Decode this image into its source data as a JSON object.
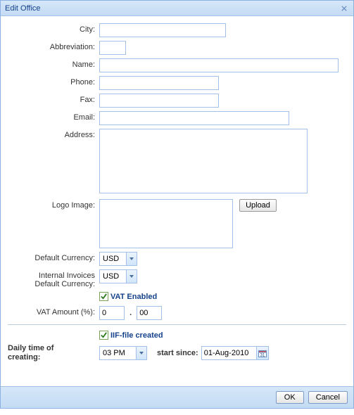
{
  "window": {
    "title": "Edit Office"
  },
  "labels": {
    "city": "City:",
    "abbreviation": "Abbreviation:",
    "name": "Name:",
    "phone": "Phone:",
    "fax": "Fax:",
    "email": "Email:",
    "address": "Address:",
    "logo": "Logo Image:",
    "def_currency": "Default Currency:",
    "int_inv_currency_l1": "Internal Invoices",
    "int_inv_currency_l2": "Default Currency:",
    "vat_enabled": "VAT Enabled",
    "vat_amount": "VAT Amount (%):",
    "iif_created": "IIF-file created",
    "daily_time_l1": "Daily time of",
    "daily_time_l2": "creating:",
    "start_since": "start since:"
  },
  "fields": {
    "city": "",
    "abbreviation": "",
    "name": "",
    "phone": "",
    "fax": "",
    "email": "",
    "address": "",
    "def_currency": "USD",
    "int_inv_currency": "USD",
    "vat_int": "0",
    "vat_dec": "00",
    "daily_time": "03 PM",
    "start_since": "01-Aug-2010"
  },
  "checks": {
    "vat_enabled": true,
    "iif_created": true
  },
  "buttons": {
    "upload": "Upload",
    "ok": "OK",
    "cancel": "Cancel"
  }
}
